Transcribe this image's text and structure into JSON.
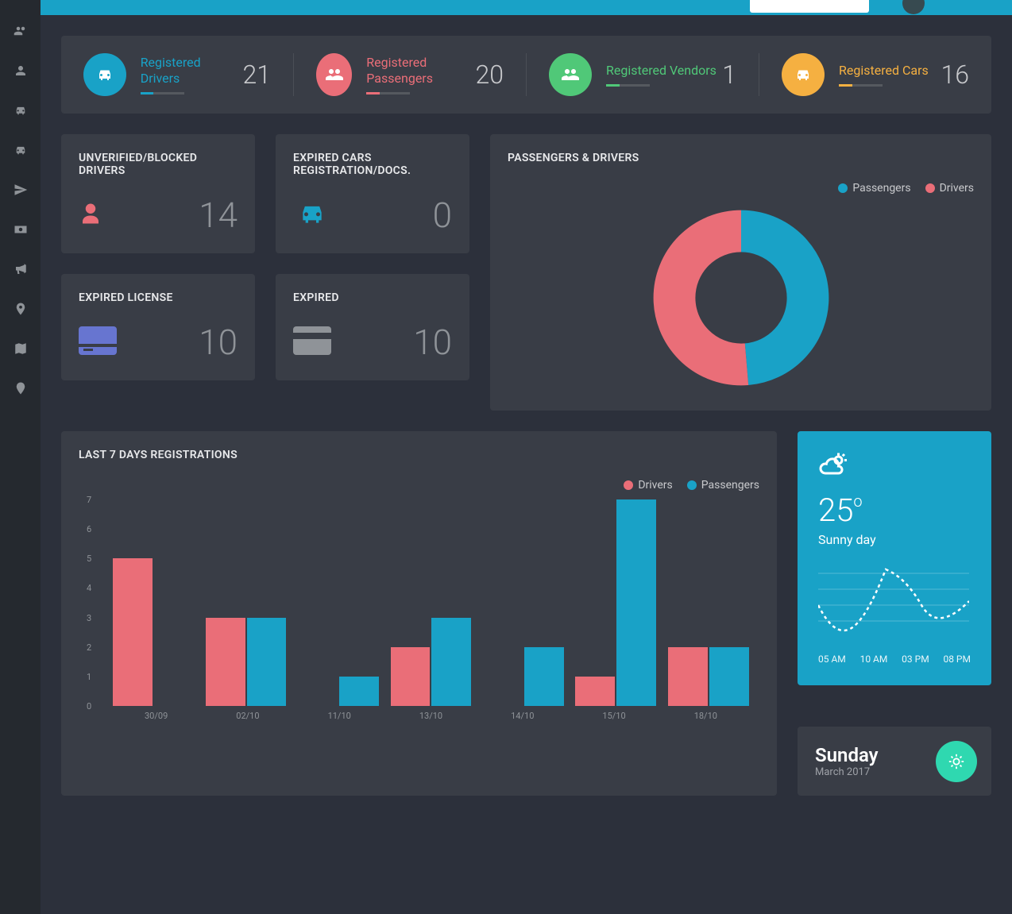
{
  "stats": [
    {
      "label": "Registered Drivers",
      "value": "21",
      "color": "#19a2c7",
      "icon": "car"
    },
    {
      "label": "Registered Passengers",
      "value": "20",
      "color": "#ea6e78",
      "icon": "users"
    },
    {
      "label": "Registered Vendors",
      "value": "1",
      "color": "#50c878",
      "icon": "users"
    },
    {
      "label": "Registered Cars",
      "value": "16",
      "color": "#f5b041",
      "icon": "car"
    }
  ],
  "cards": {
    "unverified": {
      "title": "UNVERIFIED/BLOCKED DRIVERS",
      "value": "14"
    },
    "expired_cars": {
      "title": "EXPIRED CARS REGISTRATION/DOCS.",
      "value": "0"
    },
    "expired_license": {
      "title": "EXPIRED LICENSE",
      "value": "10"
    },
    "expired": {
      "title": "EXPIRED",
      "value": "10"
    }
  },
  "donut": {
    "title": "PASSENGERS & DRIVERS",
    "legend": [
      "Passengers",
      "Drivers"
    ]
  },
  "bars": {
    "title": "LAST 7 DAYS REGISTRATIONS",
    "legend": [
      "Drivers",
      "Passengers"
    ]
  },
  "chart_data": [
    {
      "type": "pie",
      "title": "Passengers & Drivers",
      "series": [
        {
          "name": "Passengers",
          "value": 20,
          "color": "#19a2c7"
        },
        {
          "name": "Drivers",
          "value": 21,
          "color": "#ea6e78"
        }
      ]
    },
    {
      "type": "bar",
      "title": "Last 7 Days Registrations",
      "categories": [
        "30/09",
        "02/10",
        "11/10",
        "13/10",
        "14/10",
        "15/10",
        "18/10"
      ],
      "series": [
        {
          "name": "Drivers",
          "values": [
            5,
            3,
            0,
            2,
            0,
            1,
            2
          ],
          "color": "#ea6e78"
        },
        {
          "name": "Passengers",
          "values": [
            0,
            3,
            1,
            3,
            2,
            7,
            2
          ],
          "color": "#19a2c7"
        }
      ],
      "ylabel": "",
      "ylim": [
        0,
        7
      ]
    }
  ],
  "weather": {
    "temp": "25",
    "desc": "Sunny day",
    "times": [
      "05 AM",
      "10 AM",
      "03 PM",
      "08 PM"
    ],
    "day": "Sunday",
    "month": "March 2017"
  }
}
